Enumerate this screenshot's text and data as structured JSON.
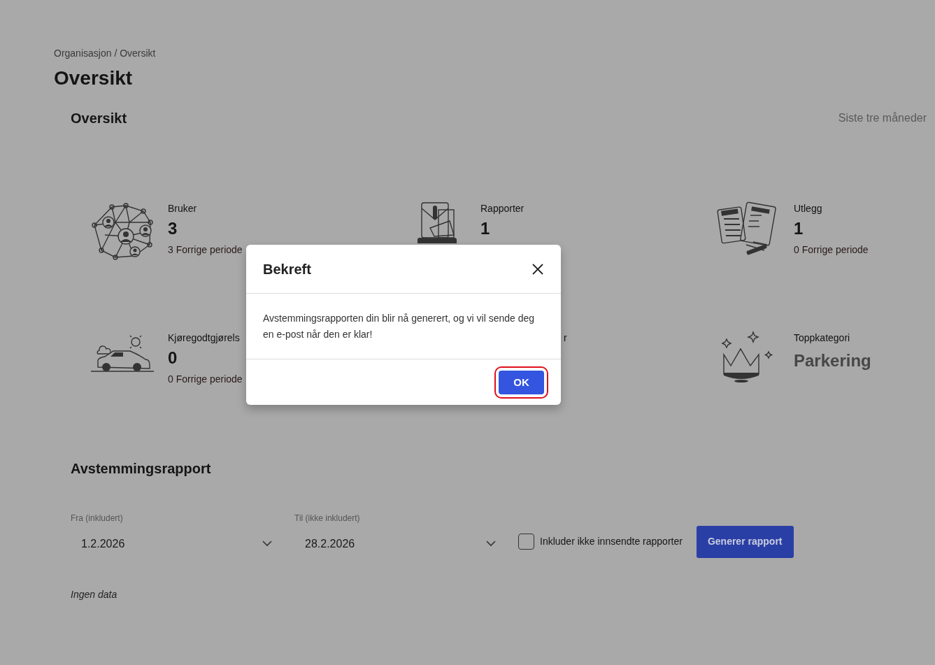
{
  "breadcrumb": "Organisasjon / Oversikt",
  "page_title": "Oversikt",
  "overview": {
    "title": "Oversikt",
    "period": "Siste tre måneder",
    "stats": [
      {
        "kind": "count",
        "label": "Bruker",
        "value": "3",
        "previous": "3 Forrige periode"
      },
      {
        "kind": "count",
        "label": "Rapporter",
        "value": "1"
      },
      {
        "kind": "count",
        "label": "Utlegg",
        "value": "1",
        "previous": "0 Forrige periode"
      },
      {
        "kind": "count",
        "label": "Kjøregodtgjørels",
        "value": "0",
        "previous": "0 Forrige periode"
      },
      {
        "kind": "covered",
        "label": "r"
      },
      {
        "kind": "category",
        "label": "Toppkategori",
        "value": "Parkering"
      }
    ]
  },
  "reconciliation": {
    "title": "Avstemmingsrapport",
    "from": {
      "label": "Fra (inkludert)",
      "value": "1.2.2026"
    },
    "to": {
      "label": "Til (ikke inkludert)",
      "value": "28.2.2026"
    },
    "include_unsubmitted": {
      "label": "Inkluder ikke innsendte rapporter",
      "checked": false
    },
    "button": "Generer rapport",
    "empty": "Ingen data"
  },
  "dialog": {
    "title": "Bekreft",
    "message": "Avstemmingsrapporten din blir nå generert, og vi vil sende deg en e-post når den er klar!",
    "ok": "OK"
  }
}
